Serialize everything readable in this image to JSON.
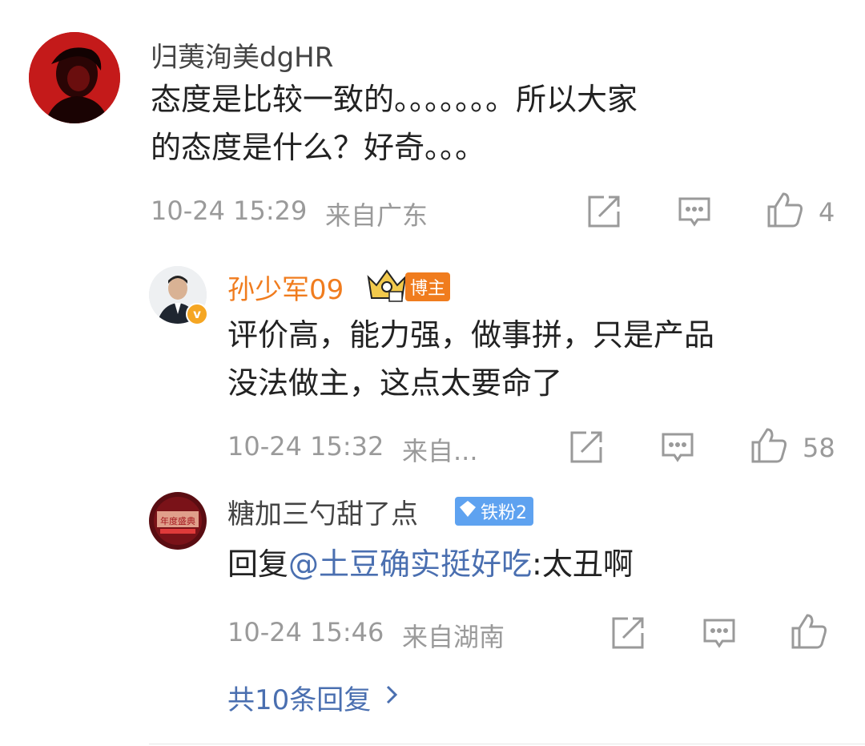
{
  "comment1": {
    "user": "归荑洵美dgHR",
    "text_line1": "态度是比较一致的。。。。。。。所以大家",
    "text_line2": "的态度是什么？好奇。。。",
    "time": "10-24 15:29",
    "location": "来自广东",
    "likes": "4"
  },
  "reply1": {
    "user": "孙少军09",
    "badge": "博主",
    "text_line1": "评价高，能力强，做事拼，只是产品",
    "text_line2": "没法做主，这点太要命了",
    "time": "10-24 15:32",
    "location": "来自...",
    "likes": "58"
  },
  "reply2": {
    "user": "糖加三勺甜了点",
    "badge": "铁粉2",
    "reply_prefix": "回复",
    "mention": "@土豆确实挺好吃",
    "text_suffix": ":太丑啊",
    "time": "10-24 15:46",
    "location": "来自湖南"
  },
  "more_replies": "共10条回复",
  "icons": {
    "share": "share-icon",
    "comment": "comment-icon",
    "like": "thumbs-up-icon",
    "chevron": "chevron-right-icon",
    "verified": "verified-v-icon",
    "crown": "crown-icon",
    "diamond": "diamond-icon"
  },
  "colors": {
    "accent_orange": "#f07c1e",
    "link_blue": "#4a6fb0",
    "meta_gray": "#9a9a9a"
  }
}
